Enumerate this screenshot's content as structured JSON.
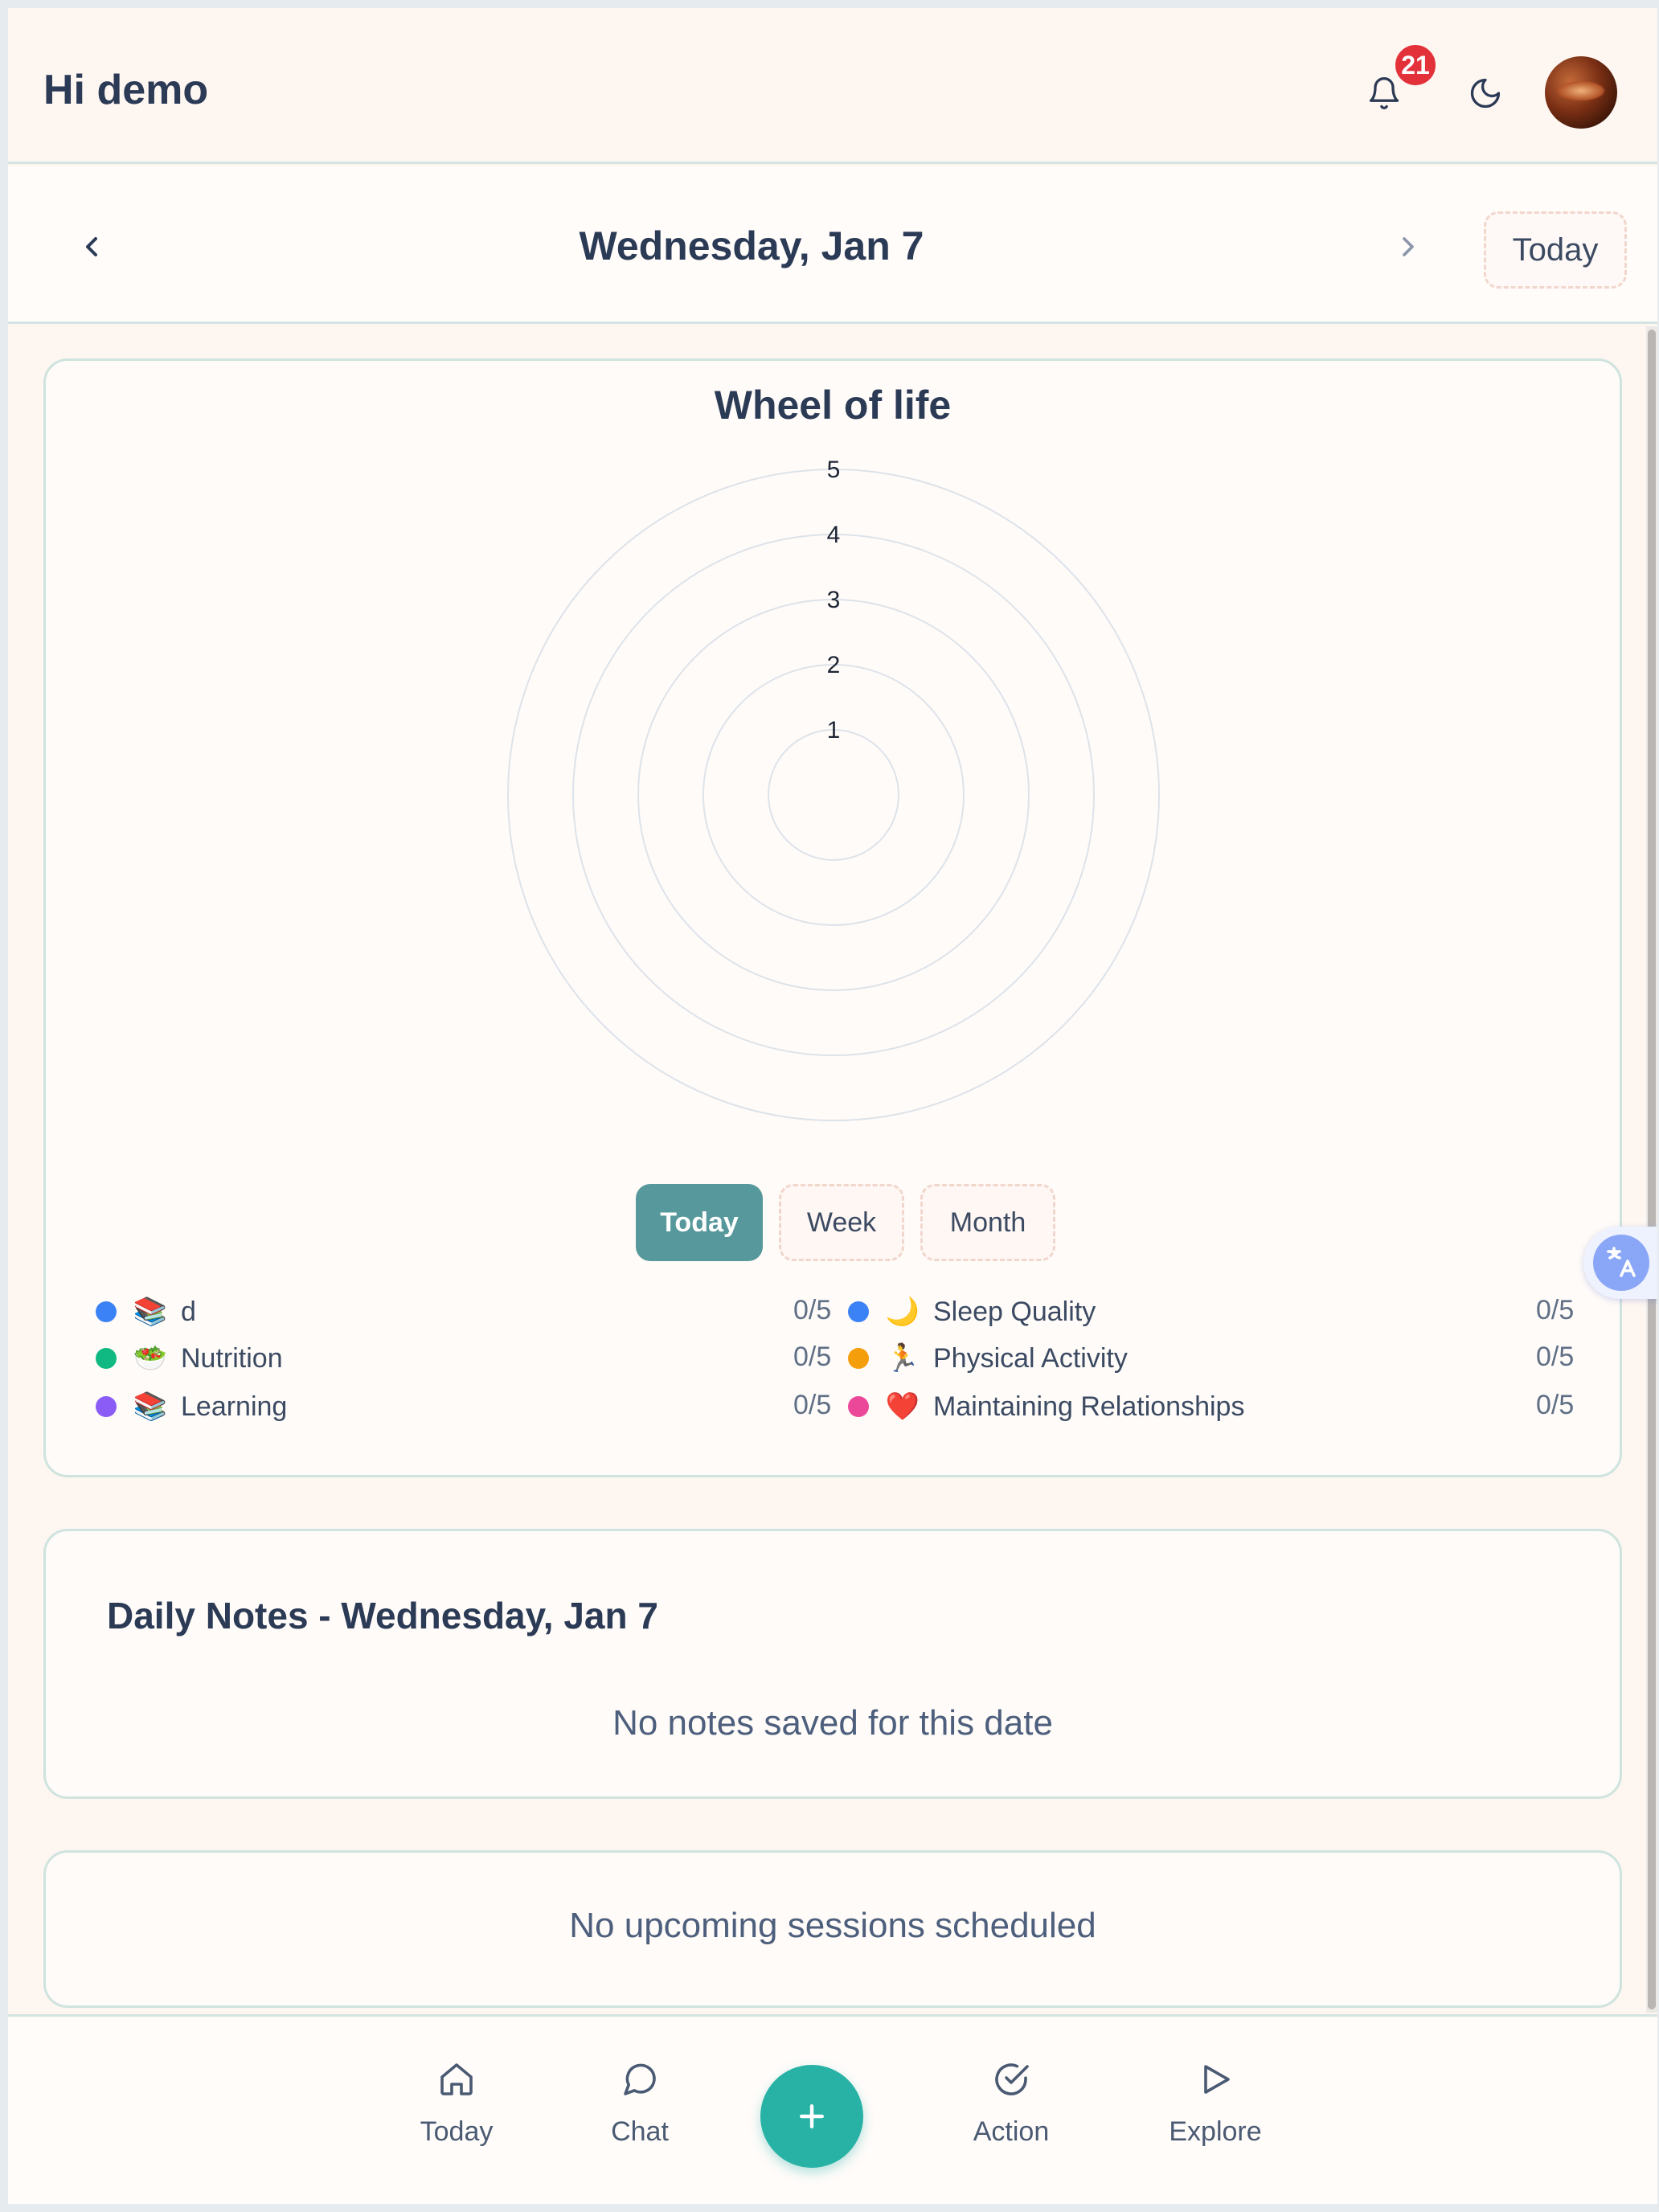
{
  "header": {
    "greeting": "Hi demo",
    "notification_count": "21",
    "icons": [
      "bell-icon",
      "moon-icon",
      "avatar"
    ]
  },
  "date_nav": {
    "title": "Wednesday, Jan 7",
    "today_label": "Today"
  },
  "wheel": {
    "title": "Wheel of life",
    "ranges": [
      "Today",
      "Week",
      "Month"
    ],
    "active_range": "Today",
    "legend": [
      {
        "label": "d",
        "emoji": "📚",
        "color": "#3b82f6",
        "score": "0/5"
      },
      {
        "label": "Sleep Quality",
        "emoji": "🌙",
        "color": "#3b82f6",
        "score": "0/5"
      },
      {
        "label": "Nutrition",
        "emoji": "🥗",
        "color": "#10b981",
        "score": "0/5"
      },
      {
        "label": "Physical Activity",
        "emoji": "🏃",
        "color": "#f59e0b",
        "score": "0/5"
      },
      {
        "label": "Learning",
        "emoji": "📚",
        "color": "#8b5cf6",
        "score": "0/5"
      },
      {
        "label": "Maintaining Relationships",
        "emoji": "❤️",
        "color": "#ec4899",
        "score": "0/5"
      }
    ]
  },
  "chart_data": {
    "type": "radar",
    "title": "Wheel of life",
    "categories": [
      "d",
      "Sleep Quality",
      "Nutrition",
      "Physical Activity",
      "Learning",
      "Maintaining Relationships"
    ],
    "values": [
      0,
      0,
      0,
      0,
      0,
      0
    ],
    "rlim": [
      0,
      5
    ],
    "ticks": [
      "1",
      "2",
      "3",
      "4",
      "5"
    ],
    "grid": true
  },
  "notes": {
    "title": "Daily Notes - Wednesday, Jan 7",
    "empty": "No notes saved for this date"
  },
  "sessions": {
    "empty": "No upcoming sessions scheduled"
  },
  "bottom_nav": {
    "today": "Today",
    "chat": "Chat",
    "fab": "+",
    "action": "Action",
    "explore": "Explore"
  }
}
